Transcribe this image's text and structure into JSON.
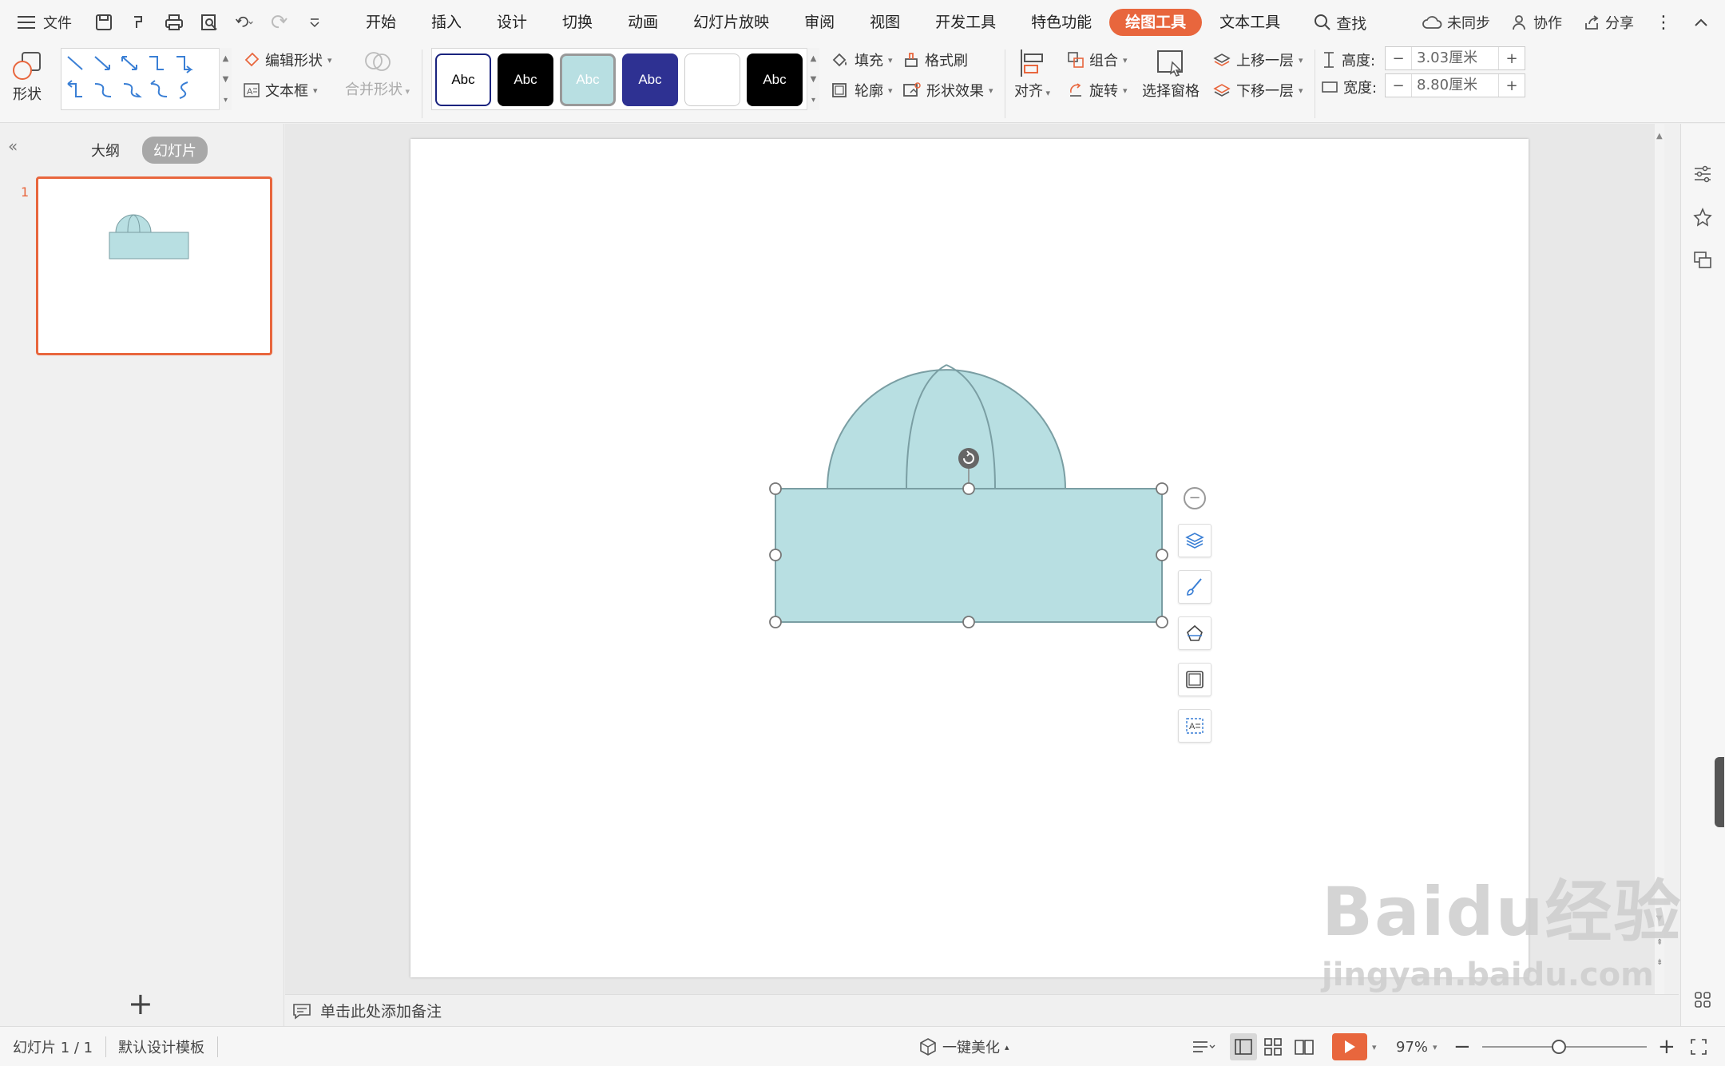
{
  "menubar": {
    "file_label": "文件",
    "tabs": [
      "开始",
      "插入",
      "设计",
      "切换",
      "动画",
      "幻灯片放映",
      "审阅",
      "视图",
      "开发工具",
      "特色功能",
      "绘图工具",
      "文本工具"
    ],
    "active_tab": "绘图工具",
    "search_label": "查找",
    "sync_label": "未同步",
    "collab_label": "协作",
    "share_label": "分享"
  },
  "ribbon": {
    "shape_label": "形状",
    "edit_shape_label": "编辑形状",
    "textbox_label": "文本框",
    "merge_shape_label": "合并形状",
    "style_swatches": [
      {
        "label": "Abc",
        "bg": "#ffffff",
        "fg": "#000000",
        "border": "#1a237e"
      },
      {
        "label": "Abc",
        "bg": "#000000",
        "fg": "#ffffff",
        "border": "#000000"
      },
      {
        "label": "Abc",
        "bg": "#b8dfe2",
        "fg": "#ffffff",
        "border": "#8fb5b8"
      },
      {
        "label": "Abc",
        "bg": "#2e3192",
        "fg": "#ffffff",
        "border": "#1f2277"
      },
      {
        "label": "",
        "bg": "#ffffff",
        "fg": "#000000",
        "border": "#cccccc"
      },
      {
        "label": "Abc",
        "bg": "#000000",
        "fg": "#ffffff",
        "border": "#000000"
      }
    ],
    "fill_label": "填充",
    "outline_label": "轮廓",
    "format_painter_label": "格式刷",
    "shape_effect_label": "形状效果",
    "align_label": "对齐",
    "group_label": "组合",
    "rotate_label": "旋转",
    "selection_pane_label": "选择窗格",
    "bring_forward_label": "上移一层",
    "send_backward_label": "下移一层",
    "height_label": "高度:",
    "height_value": "3.03厘米",
    "width_label": "宽度:",
    "width_value": "8.80厘米"
  },
  "left_panel": {
    "outline_tab": "大纲",
    "slides_tab": "幻灯片",
    "slide_number": "1"
  },
  "notes": {
    "placeholder": "单击此处添加备注"
  },
  "statusbar": {
    "slide_info": "幻灯片 1 / 1",
    "template": "默认设计模板",
    "beautify": "一键美化",
    "zoom": "97%"
  },
  "slide": {
    "shape_fill": "#b8dfe2",
    "shape_stroke": "#7a9ea3"
  },
  "watermark": {
    "brand": "Baidu经验",
    "url": "jingyan.baidu.com"
  }
}
